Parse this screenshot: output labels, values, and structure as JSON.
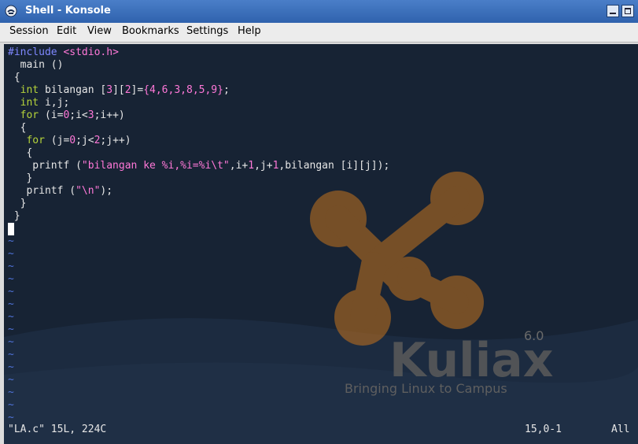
{
  "window": {
    "title": "Shell - Konsole",
    "icons": [
      "terminal-app-icon",
      "minimize-icon",
      "maximize-icon"
    ]
  },
  "menubar": {
    "items": [
      "Session",
      "Edit",
      "View",
      "Bookmarks",
      "Settings",
      "Help"
    ]
  },
  "editor": {
    "lines": [
      [
        {
          "t": "#include ",
          "c": "pre"
        },
        {
          "t": "<stdio.h>",
          "c": "inc"
        }
      ],
      [
        {
          "t": "  main ()",
          "c": ""
        }
      ],
      [
        {
          "t": " {",
          "c": ""
        }
      ],
      [
        {
          "t": "  ",
          "c": ""
        },
        {
          "t": "int",
          "c": "kw"
        },
        {
          "t": " bilangan [",
          "c": ""
        },
        {
          "t": "3",
          "c": "num"
        },
        {
          "t": "][",
          "c": ""
        },
        {
          "t": "2",
          "c": "num"
        },
        {
          "t": "]=",
          "c": ""
        },
        {
          "t": "{4,6,3,8,5,9}",
          "c": "br"
        },
        {
          "t": ";",
          "c": ""
        }
      ],
      [
        {
          "t": "  ",
          "c": ""
        },
        {
          "t": "int",
          "c": "kw"
        },
        {
          "t": " i,j;",
          "c": ""
        }
      ],
      [
        {
          "t": "  ",
          "c": ""
        },
        {
          "t": "for",
          "c": "kw"
        },
        {
          "t": " (i=",
          "c": ""
        },
        {
          "t": "0",
          "c": "num"
        },
        {
          "t": ";i<",
          "c": ""
        },
        {
          "t": "3",
          "c": "num"
        },
        {
          "t": ";i++)",
          "c": ""
        }
      ],
      [
        {
          "t": "  {",
          "c": ""
        }
      ],
      [
        {
          "t": "   ",
          "c": ""
        },
        {
          "t": "for",
          "c": "kw"
        },
        {
          "t": " (j=",
          "c": ""
        },
        {
          "t": "0",
          "c": "num"
        },
        {
          "t": ";j<",
          "c": ""
        },
        {
          "t": "2",
          "c": "num"
        },
        {
          "t": ";j++)",
          "c": ""
        }
      ],
      [
        {
          "t": "   {",
          "c": ""
        }
      ],
      [
        {
          "t": "    printf (",
          "c": ""
        },
        {
          "t": "\"bilangan ke %i,%i=%i\\t\"",
          "c": "str"
        },
        {
          "t": ",i+",
          "c": ""
        },
        {
          "t": "1",
          "c": "num"
        },
        {
          "t": ",j+",
          "c": ""
        },
        {
          "t": "1",
          "c": "num"
        },
        {
          "t": ",bilangan [i][j]);",
          "c": ""
        }
      ],
      [
        {
          "t": "   }",
          "c": ""
        }
      ],
      [
        {
          "t": "   printf (",
          "c": ""
        },
        {
          "t": "\"\\n\"",
          "c": "str"
        },
        {
          "t": ");",
          "c": ""
        }
      ],
      [
        {
          "t": "  }",
          "c": ""
        }
      ],
      [
        {
          "t": " }",
          "c": ""
        }
      ]
    ],
    "tilde_char": "~",
    "tilde_count": 15
  },
  "status": {
    "file_info": "\"LA.c\" 15L, 224C",
    "position": "15,0-1",
    "scroll": "All"
  },
  "wallpaper": {
    "brand": "Kuliax",
    "version": "6.0",
    "tagline": "Bringing Linux to Campus"
  },
  "colors": {
    "terminal_bg": "#172334",
    "keyword": "#b5d33a",
    "literal": "#ff78d8",
    "preprocessor": "#7f88ff",
    "tilde": "#4f72d8",
    "logo_orange": "#c5731d"
  }
}
